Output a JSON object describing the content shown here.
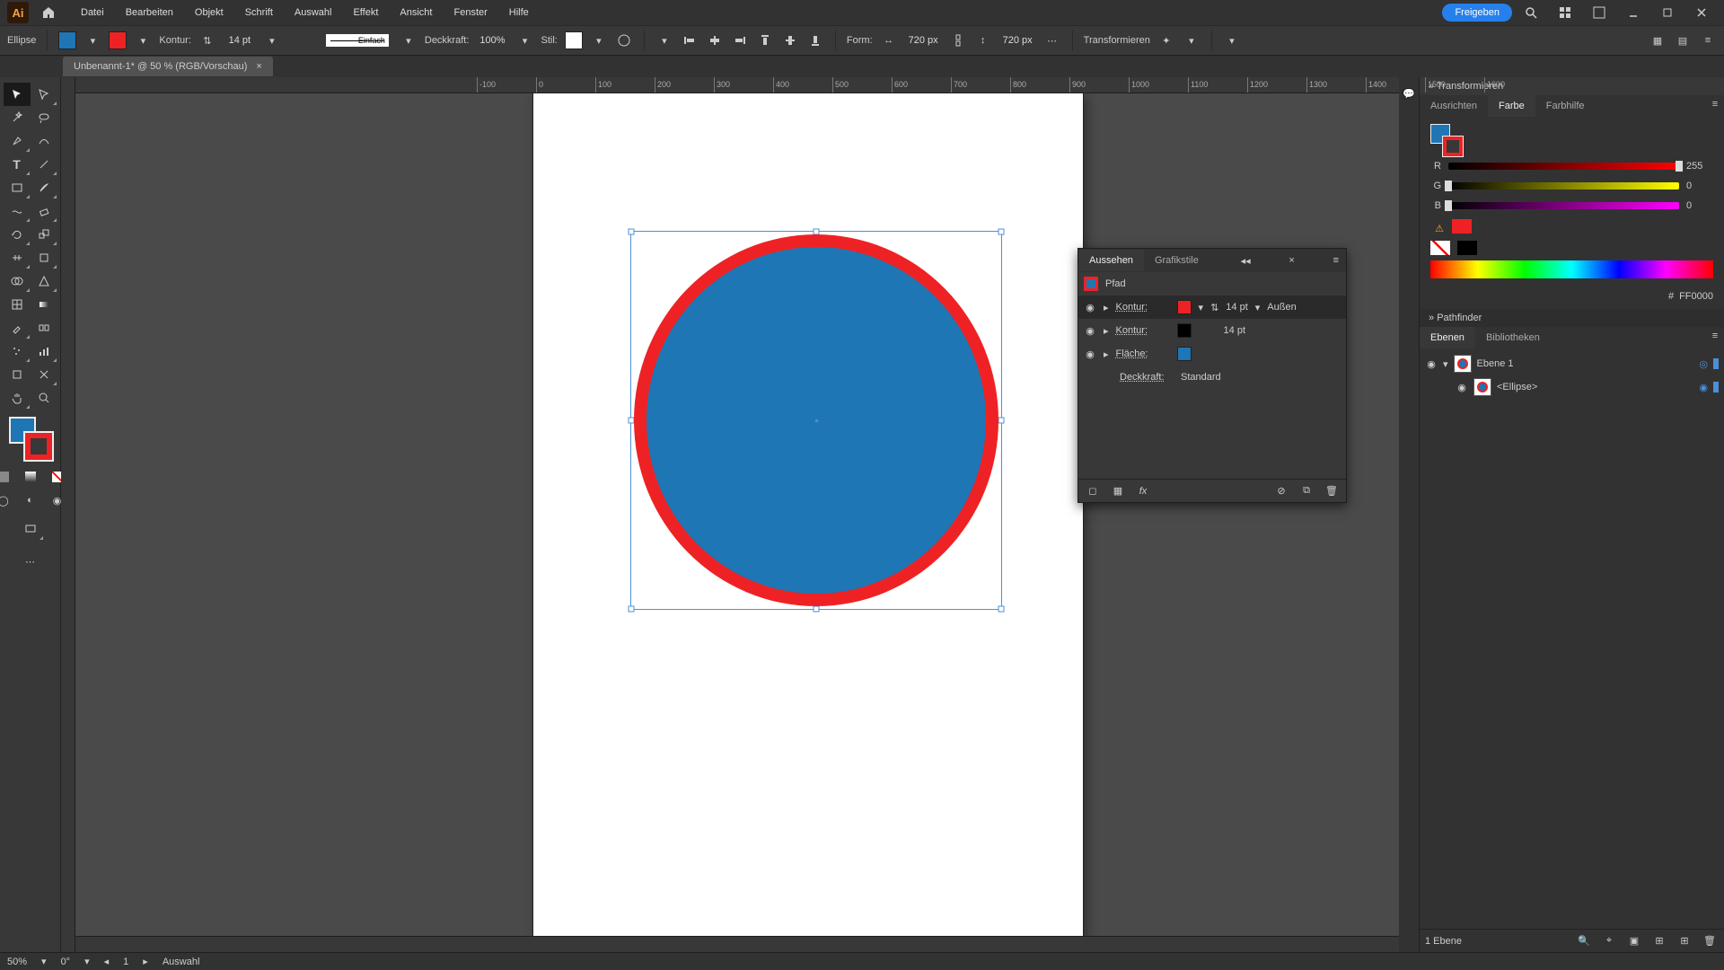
{
  "app": {
    "logo": "Ai"
  },
  "menubar": {
    "items": [
      "Datei",
      "Bearbeiten",
      "Objekt",
      "Schrift",
      "Auswahl",
      "Effekt",
      "Ansicht",
      "Fenster",
      "Hilfe"
    ],
    "share": "Freigeben"
  },
  "optbar": {
    "shape": "Ellipse",
    "kontur_label": "Kontur:",
    "kontur_size": "14 pt",
    "stroke_style": "Einfach",
    "opacity_label": "Deckkraft:",
    "opacity": "100%",
    "stil_label": "Stil:",
    "form_label": "Form:",
    "w": "720 px",
    "h": "720 px",
    "transform": "Transformieren"
  },
  "tab": {
    "title": "Unbenannt-1* @ 50 % (RGB/Vorschau)"
  },
  "ruler": {
    "marks": [
      -100,
      0,
      100,
      200,
      300,
      400,
      500,
      600,
      700,
      800,
      900,
      1000,
      1100,
      1200,
      1300,
      1400,
      1500,
      1600
    ]
  },
  "appearance": {
    "tabs": [
      "Aussehen",
      "Grafikstile"
    ],
    "path": "Pfad",
    "rows": [
      {
        "label": "Kontur:",
        "val": "14 pt",
        "align": "Außen",
        "swatch": "#ee2224",
        "sel": true
      },
      {
        "label": "Kontur:",
        "val": "14 pt",
        "swatch": "#000000"
      },
      {
        "label": "Fläche:",
        "swatch": "#1e76b4"
      }
    ],
    "opacity_label": "Deckkraft:",
    "opacity_val": "Standard"
  },
  "dock": {
    "transform_title": "Transformieren",
    "color_tabs": [
      "Ausrichten",
      "Farbe",
      "Farbhilfe"
    ],
    "sliders": [
      {
        "l": "R",
        "v": "255",
        "grad": "linear-gradient(90deg,#000,#f00)",
        "pos": "100%"
      },
      {
        "l": "G",
        "v": "0",
        "grad": "linear-gradient(90deg,#000,#ff0)",
        "pos": "0%"
      },
      {
        "l": "B",
        "v": "0",
        "grad": "linear-gradient(90deg,#000,#f0f)",
        "pos": "0%"
      }
    ],
    "hex": "FF0000",
    "pathfinder": "Pathfinder",
    "layer_tabs": [
      "Ebenen",
      "Bibliotheken"
    ],
    "layer1": "Ebene 1",
    "sublayer": "<Ellipse>",
    "layer_count": "1 Ebene"
  },
  "status": {
    "zoom": "50%",
    "angle": "0°",
    "artboard": "1",
    "tool": "Auswahl"
  }
}
